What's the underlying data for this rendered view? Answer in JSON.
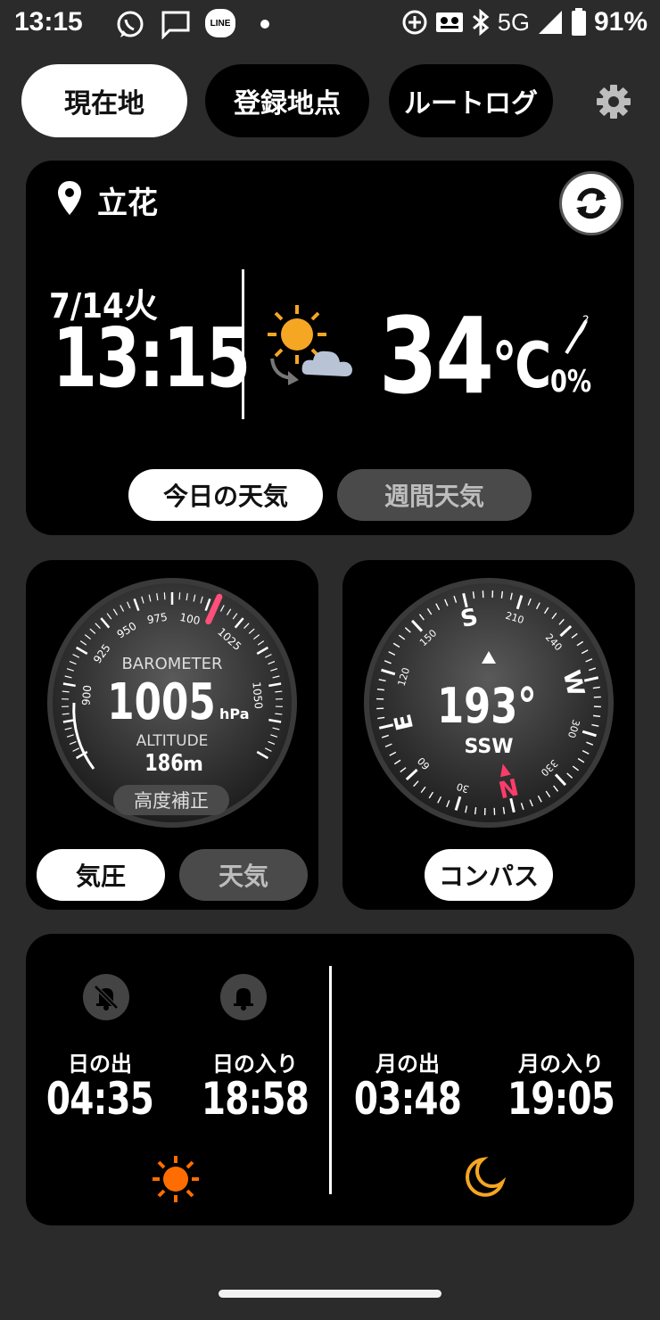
{
  "status_bar": {
    "time": "13:15",
    "network": "5G",
    "battery": "91%",
    "line_label": "LINE"
  },
  "tabs": {
    "current": "現在地",
    "registered": "登録地点",
    "routelog": "ルートログ"
  },
  "weather": {
    "location": "立花",
    "date": "7/14火",
    "time": "13:15",
    "temperature": "34",
    "unit": "°C",
    "rain_chance": "0%",
    "today_button": "今日の天気",
    "weekly_button": "週間天気"
  },
  "barometer": {
    "title": "BAROMETER",
    "pressure": "1005",
    "pressure_unit": "hPa",
    "altitude_label": "ALTITUDE",
    "altitude": "186",
    "altitude_unit": "m",
    "calibrate": "高度補正",
    "scale_labels": [
      "900",
      "925",
      "950",
      "975",
      "100",
      "1025",
      "1050"
    ],
    "pressure_button": "気圧",
    "weather_button": "天気"
  },
  "compass": {
    "heading": "193°",
    "direction": "SSW",
    "cardinals": [
      "N",
      "E",
      "S",
      "W"
    ],
    "degree_labels": [
      "30",
      "60",
      "120",
      "150",
      "210",
      "240",
      "300",
      "330"
    ],
    "button": "コンパス"
  },
  "sun_moon": {
    "sunrise_label": "日の出",
    "sunrise": "04:35",
    "sunset_label": "日の入り",
    "sunset": "18:58",
    "moonrise_label": "月の出",
    "moonrise": "03:48",
    "moonset_label": "月の入り",
    "moonset": "19:05",
    "accent_color": "#ff6d00"
  }
}
